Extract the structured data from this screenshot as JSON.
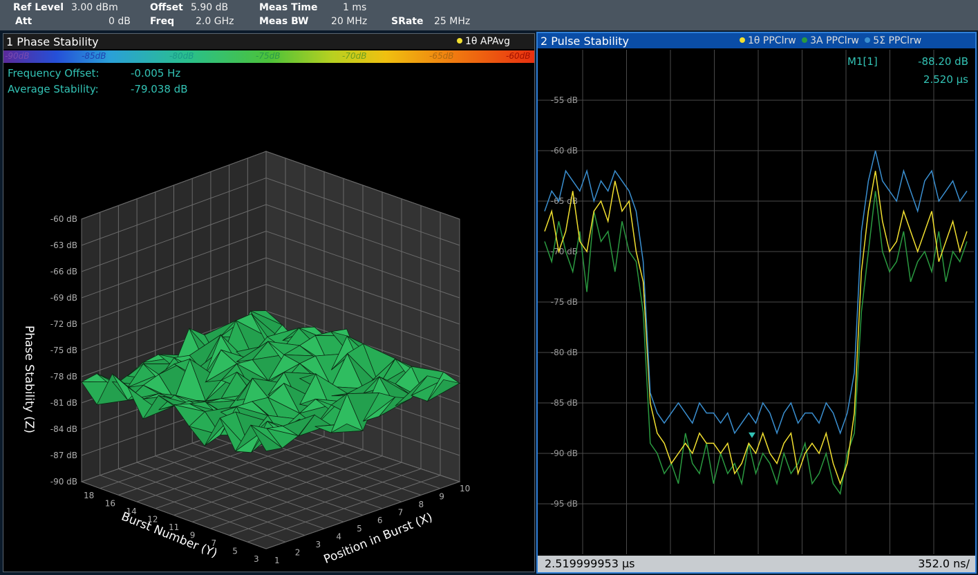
{
  "header": {
    "row1": [
      {
        "label": "Ref Level",
        "value": "3.00 dBm"
      },
      {
        "label": "Offset",
        "value": "5.90 dB"
      },
      {
        "label": "Meas Time",
        "value": "1 ms"
      }
    ],
    "row2": [
      {
        "label": "Att",
        "value": "0 dB"
      },
      {
        "label": "Freq",
        "value": "2.0 GHz"
      },
      {
        "label": "Meas BW",
        "value": "20 MHz"
      },
      {
        "label": "SRate",
        "value": "25 MHz"
      }
    ]
  },
  "panel1": {
    "title": "1 Phase Stability",
    "trace_tag": "1θ APAvg",
    "colorbar_labels": [
      "-90dB",
      "-85dB",
      "-80dB",
      "-75dB",
      "-70dB",
      "-65dB",
      "-60dB"
    ],
    "info": [
      {
        "label": "Frequency Offset:",
        "value": "-0.005 Hz"
      },
      {
        "label": "Average Stability:",
        "value": "-79.038 dB"
      }
    ],
    "z_ticks": [
      "-60 dB",
      "-63 dB",
      "-66 dB",
      "-69 dB",
      "-72 dB",
      "-75 dB",
      "-78 dB",
      "-81 dB",
      "-84 dB",
      "-87 dB",
      "-90 dB"
    ],
    "y_ticks": [
      "18",
      "16",
      "14",
      "12",
      "11",
      "9",
      "7",
      "5",
      "3"
    ],
    "x_ticks": [
      "1",
      "2",
      "3",
      "4",
      "5",
      "6",
      "7",
      "8",
      "9",
      "10"
    ],
    "z_label": "Phase Stability (Z)",
    "y_label": "Burst Number (Y)",
    "x_label": "Position in Burst (X)",
    "colors": {
      "surface": "#27ad55",
      "surface_edge": "#0c2a14",
      "grid": "#6a6a6a",
      "axis_text": "#b0b0b0"
    }
  },
  "panel2": {
    "title": "2 Pulse Stability",
    "traces": [
      {
        "tag": "1θ PPClrw",
        "color": "#f2e030"
      },
      {
        "tag": "3A PPClrw",
        "color": "#2a9a40"
      },
      {
        "tag": "5Σ PPClrw",
        "color": "#3a8fd0"
      }
    ],
    "marker_label": "M1[1]",
    "marker_level": "-88.20 dB",
    "marker_time": "2.520 µs",
    "y_ticks": [
      "-55 dB",
      "-60 dB",
      "-65 dB",
      "-70 dB",
      "-75 dB",
      "-80 dB",
      "-85 dB",
      "-90 dB",
      "-95 dB"
    ],
    "footer_left": "2.519999953 µs",
    "footer_right": "352.0 ns/",
    "chart_data": {
      "type": "line",
      "ylim": [
        -100,
        -50
      ],
      "series": [
        {
          "name": "1θ PPClrw",
          "color": "#f2e030",
          "values": [
            -68,
            -66,
            -70,
            -68,
            -64,
            -69,
            -70,
            -66,
            -65,
            -67,
            -63,
            -66,
            -65,
            -70,
            -73,
            -85,
            -88,
            -89,
            -91,
            -90,
            -89,
            -90,
            -88,
            -89,
            -89,
            -90,
            -89,
            -92,
            -91,
            -89,
            -90,
            -88,
            -90,
            -91,
            -89,
            -88,
            -92,
            -90,
            -89,
            -90,
            -88,
            -91,
            -93,
            -91,
            -86,
            -72,
            -66,
            -62,
            -67,
            -70,
            -69,
            -66,
            -68,
            -70,
            -68,
            -66,
            -71,
            -69,
            -67,
            -70,
            -68
          ]
        },
        {
          "name": "3A PPClrw",
          "color": "#2a9a40",
          "values": [
            -69,
            -71,
            -67,
            -70,
            -72,
            -68,
            -74,
            -66,
            -69,
            -68,
            -72,
            -67,
            -70,
            -71,
            -76,
            -89,
            -90,
            -92,
            -91,
            -93,
            -88,
            -91,
            -92,
            -89,
            -93,
            -90,
            -92,
            -91,
            -93,
            -89,
            -92,
            -90,
            -91,
            -93,
            -90,
            -92,
            -91,
            -89,
            -93,
            -92,
            -90,
            -93,
            -94,
            -90,
            -88,
            -76,
            -70,
            -64,
            -70,
            -72,
            -71,
            -68,
            -73,
            -71,
            -70,
            -72,
            -68,
            -73,
            -70,
            -71,
            -69
          ]
        },
        {
          "name": "5Σ PPClrw",
          "color": "#3a8fd0",
          "values": [
            -66,
            -64,
            -65,
            -62,
            -63,
            -64,
            -62,
            -65,
            -63,
            -64,
            -62,
            -63,
            -64,
            -66,
            -71,
            -84,
            -86,
            -87,
            -86,
            -85,
            -86,
            -87,
            -85,
            -86,
            -86,
            -87,
            -86,
            -88,
            -87,
            -86,
            -87,
            -85,
            -86,
            -88,
            -86,
            -85,
            -87,
            -86,
            -86,
            -87,
            -85,
            -86,
            -88,
            -86,
            -82,
            -68,
            -63,
            -60,
            -63,
            -64,
            -65,
            -62,
            -64,
            -66,
            -63,
            -62,
            -65,
            -64,
            -63,
            -65,
            -64
          ]
        }
      ]
    },
    "colors": {
      "grid": "#4a4a4a",
      "axis_text": "#9a9a9a",
      "marker_text": "#33c3b5"
    }
  }
}
